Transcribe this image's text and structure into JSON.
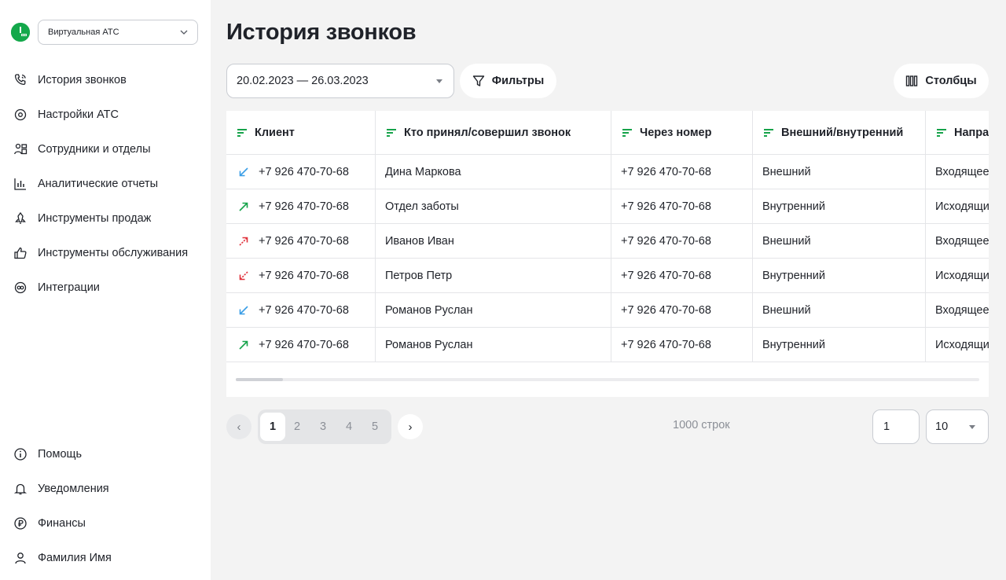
{
  "sidebar": {
    "pbx_selector": "Виртуальная АТС",
    "nav_top": [
      {
        "label": "История звонков",
        "icon": "phone-history-icon"
      },
      {
        "label": "Настройки АТС",
        "icon": "settings-gear-icon"
      },
      {
        "label": "Сотрудники и отделы",
        "icon": "users-icon"
      },
      {
        "label": "Аналитические отчеты",
        "icon": "bar-chart-icon"
      },
      {
        "label": "Инструменты продаж",
        "icon": "sales-tools-icon"
      },
      {
        "label": "Инструменты обслуживания",
        "icon": "thumbs-up-icon"
      },
      {
        "label": "Интеграции",
        "icon": "integrations-icon"
      }
    ],
    "nav_bottom": [
      {
        "label": "Помощь",
        "icon": "info-circle-icon"
      },
      {
        "label": "Уведомления",
        "icon": "bell-icon"
      },
      {
        "label": "Финансы",
        "icon": "ruble-icon"
      },
      {
        "label": "Фамилия Имя",
        "icon": "user-icon"
      }
    ]
  },
  "main": {
    "title": "История звонков",
    "date_range": "20.02.2023 — 26.03.2023",
    "filters_label": "Фильтры",
    "columns_label": "Столбцы",
    "table": {
      "headers": [
        "Клиент",
        "Кто принял/совершил звонок",
        "Через номер",
        "Внешний/внутренний",
        "Напра"
      ],
      "rows": [
        {
          "direction": "incoming",
          "client": "+7 926 470-70-68",
          "operator": "Дина Маркова",
          "via_number": "+7 926 470-70-68",
          "type": "Внешний",
          "dir_text": "Входящее"
        },
        {
          "direction": "outgoing",
          "client": "+7 926 470-70-68",
          "operator": "Отдел заботы",
          "via_number": "+7 926 470-70-68",
          "type": "Внутренний",
          "dir_text": "Исходящи"
        },
        {
          "direction": "outgoing-missed",
          "client": "+7 926 470-70-68",
          "operator": "Иванов Иван",
          "via_number": "+7 926 470-70-68",
          "type": "Внешний",
          "dir_text": "Входящее"
        },
        {
          "direction": "incoming-missed",
          "client": "+7 926 470-70-68",
          "operator": "Петров Петр",
          "via_number": "+7 926 470-70-68",
          "type": "Внутренний",
          "dir_text": "Исходящи"
        },
        {
          "direction": "incoming",
          "client": "+7 926 470-70-68",
          "operator": "Романов Руслан",
          "via_number": "+7 926 470-70-68",
          "type": "Внешний",
          "dir_text": "Входящее"
        },
        {
          "direction": "outgoing",
          "client": "+7 926 470-70-68",
          "operator": "Романов Руслан",
          "via_number": "+7 926 470-70-68",
          "type": "Внутренний",
          "dir_text": "Исходящи"
        }
      ]
    },
    "pagination": {
      "pages": [
        "1",
        "2",
        "3",
        "4",
        "5"
      ],
      "current": "1",
      "row_count": "1000 строк",
      "page_input": "1",
      "per_page": "10"
    },
    "colors": {
      "incoming": "#3a9ee6",
      "outgoing": "#16a34a",
      "missed": "#e0323c",
      "brand": "#14a84b"
    }
  }
}
